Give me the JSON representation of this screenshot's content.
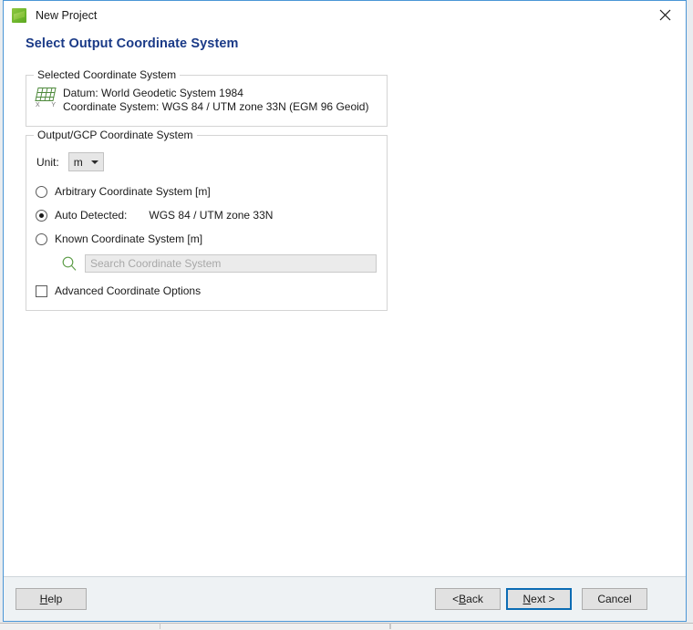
{
  "window": {
    "title": "New Project",
    "icon": "app-leaf-icon",
    "close_icon": "close-icon"
  },
  "page": {
    "heading": "Select Output Coordinate System"
  },
  "selected_coordinate_system": {
    "group_title": "Selected Coordinate System",
    "icon": "coordinate-grid-icon",
    "axis_x_label": "X",
    "axis_y_label": "Y",
    "datum_line": "Datum: World Geodetic System 1984",
    "coordinate_system_line": "Coordinate System: WGS 84 / UTM zone 33N (EGM 96 Geoid)"
  },
  "output_coordinate_system": {
    "group_title": "Output/GCP Coordinate System",
    "unit_label": "Unit:",
    "unit_value": "m",
    "unit_options": [
      "m"
    ],
    "options": [
      {
        "label": "Arbitrary Coordinate System [m]",
        "selected": false,
        "value": ""
      },
      {
        "label": "Auto Detected:",
        "selected": true,
        "value": "WGS 84 / UTM zone 33N"
      },
      {
        "label": "Known Coordinate System [m]",
        "selected": false,
        "value": ""
      }
    ],
    "search": {
      "icon": "search-icon",
      "placeholder": "Search Coordinate System",
      "value": "",
      "enabled": false
    },
    "advanced": {
      "label": "Advanced Coordinate Options",
      "checked": false
    }
  },
  "footer": {
    "help": {
      "prefix": "",
      "accel": "H",
      "suffix": "elp"
    },
    "back": {
      "prefix": "< ",
      "accel": "B",
      "suffix": "ack"
    },
    "next": {
      "prefix": "",
      "accel": "N",
      "suffix": "ext >"
    },
    "cancel": {
      "prefix": "Cancel",
      "accel": "",
      "suffix": ""
    }
  },
  "colors": {
    "heading": "#1a3a87",
    "dialog_border": "#4b96d6",
    "focus_border": "#0b6cb4",
    "accent_green": "#6fb72d",
    "footer_bg": "#eef2f4"
  }
}
